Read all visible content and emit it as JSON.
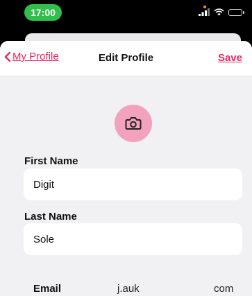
{
  "status_bar": {
    "time": "17:00"
  },
  "nav": {
    "back_label": "My Profile",
    "title": "Edit Profile",
    "save_label": "Save"
  },
  "avatar": {
    "icon": "camera-icon"
  },
  "form": {
    "first_name": {
      "label": "First Name",
      "value": "Digit"
    },
    "last_name": {
      "label": "Last Name",
      "value": "Sole"
    },
    "email": {
      "label": "Email",
      "value_start": "j.auk",
      "value_end": "com"
    }
  },
  "colors": {
    "accent": "#e8265e",
    "time_pill": "#2fbf4a",
    "avatar_bg": "#f2a2bd",
    "sheet_bg": "#f1f1f3"
  }
}
